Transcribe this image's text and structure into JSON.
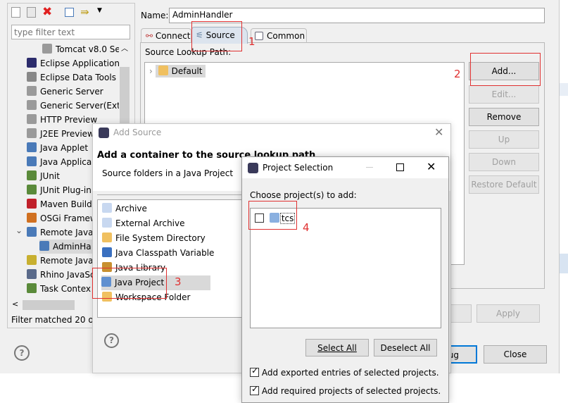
{
  "toolbar": {
    "icons": [
      "new-config-icon",
      "duplicate-icon",
      "delete-icon",
      "collapse-all-icon",
      "filter-icon",
      "dropdown-icon"
    ]
  },
  "filter": {
    "placeholder": "type filter text",
    "status": "Filter matched 20 of"
  },
  "tree": {
    "items": [
      {
        "label": "Tomcat v8.0 Ser",
        "icon": "server-icon",
        "color": "#9a9a9a",
        "indent": 2
      },
      {
        "label": "Eclipse Application",
        "icon": "eclipse-icon",
        "color": "#2c2c6c",
        "indent": 1
      },
      {
        "label": "Eclipse Data Tools",
        "icon": "database-icon",
        "color": "#888888",
        "indent": 1
      },
      {
        "label": "Generic Server",
        "icon": "server-icon",
        "color": "#9a9a9a",
        "indent": 1
      },
      {
        "label": "Generic Server(Exte",
        "icon": "server-icon",
        "color": "#9a9a9a",
        "indent": 1
      },
      {
        "label": "HTTP Preview",
        "icon": "server-icon",
        "color": "#9a9a9a",
        "indent": 1
      },
      {
        "label": "J2EE Preview",
        "icon": "server-icon",
        "color": "#9a9a9a",
        "indent": 1
      },
      {
        "label": "Java Applet",
        "icon": "applet-icon",
        "color": "#4a7ab8",
        "indent": 1
      },
      {
        "label": "Java Applica",
        "icon": "java-app-icon",
        "color": "#4a7ab8",
        "indent": 1
      },
      {
        "label": "JUnit",
        "icon": "junit-icon",
        "color": "#5a8a3a",
        "indent": 1
      },
      {
        "label": "JUnit Plug-in",
        "icon": "junit-plugin-icon",
        "color": "#5a8a3a",
        "indent": 1
      },
      {
        "label": "Maven Build",
        "icon": "maven-icon",
        "color": "#c0202a",
        "indent": 1
      },
      {
        "label": "OSGi Framew",
        "icon": "osgi-icon",
        "color": "#d07020",
        "indent": 1
      },
      {
        "label": "Remote Java",
        "icon": "remote-java-icon",
        "color": "#4a7ab8",
        "indent": 1,
        "expanded": true
      },
      {
        "label": "AdminHa",
        "icon": "remote-java-icon",
        "color": "#4a7ab8",
        "indent": 2,
        "selected": true
      },
      {
        "label": "Remote Java",
        "icon": "remote-app-icon",
        "color": "#c8b030",
        "indent": 1
      },
      {
        "label": "Rhino JavaSc",
        "icon": "rhino-icon",
        "color": "#5a6a8a",
        "indent": 1
      },
      {
        "label": "Task Contex",
        "icon": "task-icon",
        "color": "#5a8a3a",
        "indent": 1
      }
    ]
  },
  "config": {
    "name_label": "Name:",
    "name_value": "AdminHandler",
    "tabs": [
      {
        "label": "Connect",
        "icon": "connect-icon"
      },
      {
        "label": "Source",
        "icon": "source-icon",
        "active": true
      },
      {
        "label": "Common",
        "icon": "common-icon"
      }
    ],
    "lookup_label": "Source Lookup Path:",
    "lookup_items": [
      {
        "label": "Default"
      }
    ],
    "buttons": {
      "add": "Add...",
      "edit": "Edit...",
      "remove": "Remove",
      "up": "Up",
      "down": "Down",
      "restore": "Restore Default"
    },
    "apply": "Apply",
    "revert": "t",
    "debug": "ug",
    "close": "Close"
  },
  "add_source": {
    "title": "Add Source",
    "heading": "Add a container to the source lookup path",
    "subheading": "Source folders in a Java Project",
    "items": [
      {
        "label": "Archive",
        "color": "#c8d8f0"
      },
      {
        "label": "External Archive",
        "color": "#c8d8f0"
      },
      {
        "label": "File System Directory",
        "color": "#f0c060"
      },
      {
        "label": "Java Classpath Variable",
        "color": "#3a70c0"
      },
      {
        "label": "Java Library",
        "color": "#c89030"
      },
      {
        "label": "Java Project",
        "color": "#6090d0",
        "selected": true
      },
      {
        "label": "Workspace Folder",
        "color": "#f0c060"
      }
    ]
  },
  "project_selection": {
    "title": "Project Selection",
    "prompt": "Choose project(s) to add:",
    "projects": [
      {
        "label": "tcs",
        "checked": false
      }
    ],
    "select_all": "Select All",
    "deselect_all": "Deselect All",
    "options": [
      {
        "label": "Add exported entries of selected projects.",
        "checked": true
      },
      {
        "label": "Add required projects of selected projects.",
        "checked": true
      }
    ]
  },
  "annotations": [
    "1",
    "2",
    "3",
    "4"
  ],
  "colors": {
    "annotation": "#e03030",
    "dialog_bg": "#f0f0f0",
    "selection": "#d9d9d9",
    "focus": "#0078d7"
  }
}
